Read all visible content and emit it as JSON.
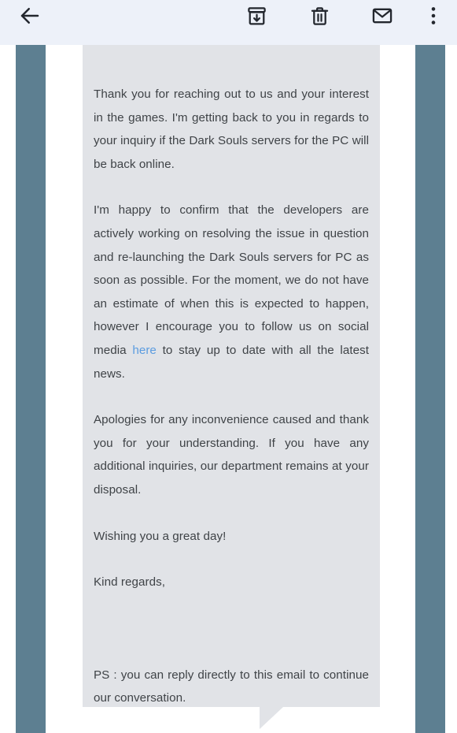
{
  "toolbar": {
    "back_label": "Back",
    "archive_label": "Archive",
    "delete_label": "Delete",
    "mark_unread_label": "Mark as unread",
    "more_label": "More options",
    "icons": {
      "back": "arrow-left-icon",
      "archive": "archive-box-down-arrow-icon",
      "delete": "trash-can-icon",
      "mark_unread": "envelope-icon",
      "more": "three-dot-vertical-menu-icon"
    },
    "bg_color": "#edf1f9",
    "icon_color": "#23272e"
  },
  "rails": {
    "color": "#5d7f91",
    "left_label": "left-accent-rail",
    "right_label": "right-accent-rail"
  },
  "message": {
    "bubble_color": "#e1e3e7",
    "text_color": "#3f4347",
    "link_color": "#5b9ce0",
    "clipped_top_line": "",
    "paragraphs": [
      {
        "id": "p1",
        "text": "Thank you for reaching out to us and your interest in the games. I'm getting back to you in regards to your inquiry if the Dark Souls servers for the PC will be back online."
      },
      {
        "id": "p2a",
        "text": "I'm happy to confirm that the developers are actively working on resolving the issue in question and re-launching the Dark Souls servers for PC as soon as possible. For the moment, we do not have an estimate of when this is expected to happen, however I encourage you to follow us on social media "
      },
      {
        "id": "p2_link",
        "text": "here"
      },
      {
        "id": "p2b",
        "text": " to stay up to date with all the latest news."
      },
      {
        "id": "p3",
        "text": "Apologies for any inconvenience caused and thank you for your understanding. If you have any additional inquiries, our department remains at your disposal."
      },
      {
        "id": "p4",
        "text": "Wishing you a great day!"
      },
      {
        "id": "p5",
        "text": "Kind regards,"
      },
      {
        "id": "p6",
        "text": "PS : you can reply directly to this email to continue our conversation."
      }
    ]
  }
}
